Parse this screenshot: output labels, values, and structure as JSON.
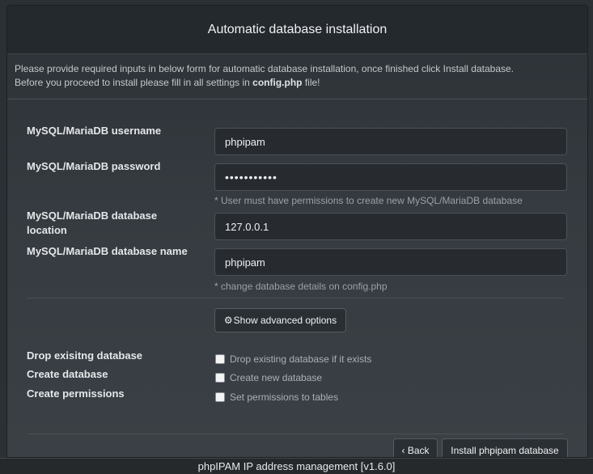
{
  "panel": {
    "title": "Automatic database installation",
    "intro_line1": "Please provide required inputs in below form for automatic database installation, once finished click Install database.",
    "intro_line2_before": "Before you proceed to install please fill in all settings in ",
    "intro_line2_file": "config.php",
    "intro_line2_after": " file!"
  },
  "form": {
    "username_label": "MySQL/MariaDB username",
    "username_value": "phpipam",
    "password_label": "MySQL/MariaDB password",
    "password_value": "•••••••••••",
    "password_help": "* User must have permissions to create new MySQL/MariaDB database",
    "location_label_line1": "MySQL/MariaDB database",
    "location_label_line2": "location",
    "location_value": "127.0.0.1",
    "dbname_label": "MySQL/MariaDB database name",
    "dbname_value": "phpipam",
    "dbname_help": "* change database details on config.php",
    "advanced_button": "Show advanced options"
  },
  "advanced": {
    "drop_label": "Drop exisitng database",
    "drop_checkbox": "Drop existing database if it exists",
    "create_label": "Create database",
    "create_checkbox": "Create new database",
    "perm_label": "Create permissions",
    "perm_checkbox": "Set permissions to tables"
  },
  "actions": {
    "back": "‹ Back",
    "install": "Install phpipam database"
  },
  "footer": {
    "text": "phpIPAM IP address management [v1.6.0]"
  },
  "icons": {
    "gear": "gear-icon",
    "back_chevron": "chevron-left-icon"
  },
  "colors": {
    "background": "#2b3034",
    "heading_bg": "#24292d",
    "input_bg": "#272b2f"
  }
}
